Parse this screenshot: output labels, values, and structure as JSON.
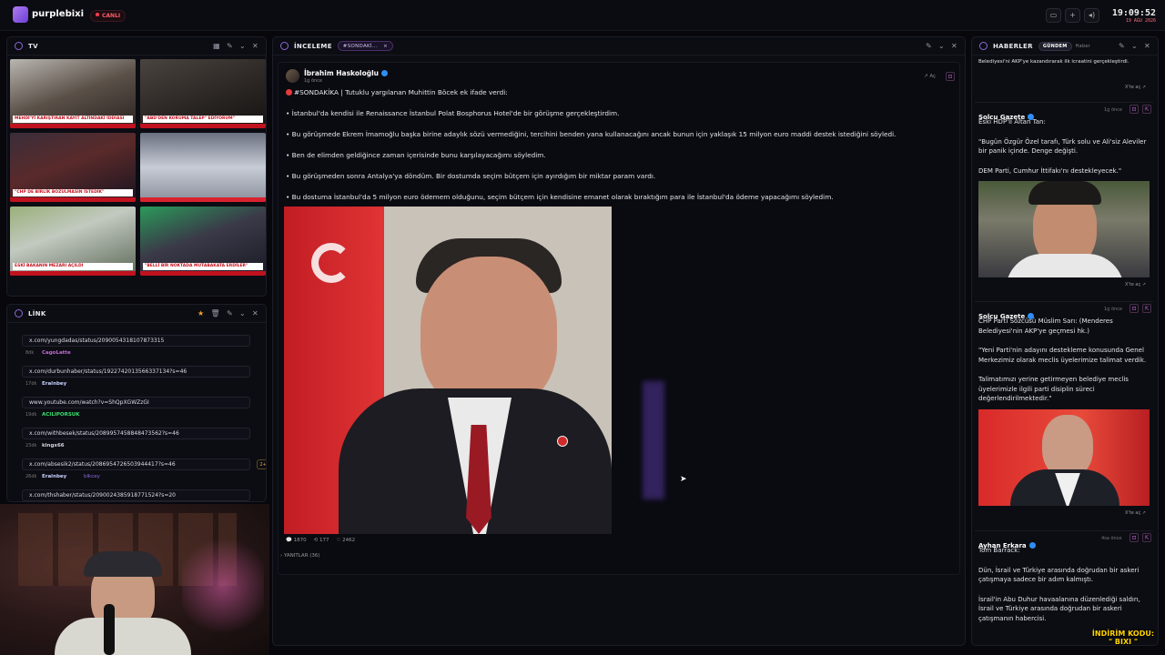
{
  "topbar": {
    "logo": "purplebixi",
    "live": "CANLI",
    "clock": "19:09:52",
    "date": "19 AĞU 2026"
  },
  "tv": {
    "title": "TV",
    "tiles": [
      {
        "caption": "MEHDİ'Yİ KARIŞTIRAN KAYIT ALTINDAKİ İDDİASI"
      },
      {
        "caption": "\"ABD'DEN KORUMA TALEP\" EDİYORUM\""
      },
      {
        "caption": "\"CHP DE BİRLİK BOZULMASIN İSTEDİK\""
      },
      {
        "caption": ""
      },
      {
        "caption": "ESKİ BAKANIN MEZARI AÇILDI"
      },
      {
        "caption": "\"BELLİ BİR NOKTADA MUTABAKATA ERDİLER\""
      }
    ]
  },
  "link": {
    "title": "LİNK",
    "items": [
      {
        "url": "x.com/yungdadas/status/2090054318107873315",
        "age": "8dk",
        "user": "CagoLatte",
        "user_color": "#c46ad6",
        "extra": "",
        "badge": ""
      },
      {
        "url": "x.com/durbunhaber/status/1922742013566337134?s=46",
        "age": "17dk",
        "user": "Eralnbey",
        "user_color": "#c9d3ff",
        "extra": "",
        "badge": ""
      },
      {
        "url": "www.youtube.com/watch?v=ShQpXGWZzGI",
        "age": "19dk",
        "user": "ACILIPORSUK",
        "user_color": "#38e06b",
        "extra": "",
        "badge": ""
      },
      {
        "url": "x.com/withbesek/status/2089957458848473562?s=46",
        "age": "23dk",
        "user": "klngx66",
        "user_color": "#d6d6e0",
        "extra": "",
        "badge": ""
      },
      {
        "url": "x.com/absesik2/status/2086954726503944417?s=46",
        "age": "26dk",
        "user": "Eralnbey",
        "user_color": "#c9d3ff",
        "extra": "blkcey",
        "badge": "2+"
      },
      {
        "url": "x.com/thshaber/status/2090024385918771524?s=20",
        "age": "",
        "user": "",
        "user_color": "#d6d6e0",
        "extra": "",
        "badge": ""
      }
    ]
  },
  "inceleme": {
    "title": "İNCELEME",
    "tab": "#SONDAKİ...",
    "author": "İbrahim Haskoloğlu",
    "time": "1g önce",
    "open": "Aç",
    "lines": [
      "#SONDAKİKA | Tutuklu yargılanan Muhittin Böcek ek ifade verdi:",
      "• İstanbul'da kendisi ile Renaissance İstanbul Polat Bosphorus Hotel'de bir görüşme gerçekleştirdim.",
      "• Bu görüşmede Ekrem İmamoğlu başka birine adaylık sözü vermediğini, tercihini benden yana kullanacağını ancak bunun için yaklaşık 15 milyon euro maddi destek istediğini söyledi.",
      "• Ben de elimden geldiğince zaman içerisinde bunu karşılayacağımı söyledim.",
      "• Bu görüşmeden sonra Antalya'ya döndüm. Bir dostumda seçim bütçem için ayırdığım bir miktar param vardı.",
      "• Bu dostuma İstanbul'da 5 milyon euro ödemem olduğunu, seçim bütçem için kendisine emanet olarak bıraktığım para ile İstanbul'da ödeme yapacağımı söyledim."
    ],
    "replies": "1870",
    "reposts": "177",
    "likes": "2462",
    "thread": "YANITLAR (36)"
  },
  "news": {
    "title": "HABERLER",
    "tabs": [
      "GÜNDEM",
      "Haber"
    ],
    "open_label": "X'te aç",
    "top_text": "Belediyesi'ni AKP'ye kazandırarak ilk icraatini gerçekleştirdi.",
    "items": [
      {
        "source": "Solcu Gazete",
        "time": "1g önce",
        "body": [
          "Eski HDP'li Altan Tan:",
          "",
          "\"Bugün Özgür Özel tarafı, Türk solu ve Ali'siz Aleviler bir panik içinde. Denge değişti.",
          "",
          "DEM Parti, Cumhur İttifakı'nı destekleyecek.\""
        ]
      },
      {
        "source": "Solcu Gazete",
        "time": "1g önce",
        "body": [
          "CHP Parti Sözcüsü Müslim Sarı: (Menderes Belediyesi'nin AKP'ye geçmesi hk.)",
          "",
          "\"Yeni Parti'nin adayını destekleme konusunda Genel Merkezimiz olarak meclis üyelerimize talimat verdik.",
          "",
          "Talimatımızı yerine getirmeyen belediye meclis üyelerimizle ilgili parti disiplin süreci değerlendirilmektedir.\""
        ]
      },
      {
        "source": "Ayhan Erkara",
        "time": "4sa önce",
        "body": [
          "Tom Barrack:",
          "",
          "Dün, İsrail ve Türkiye arasında doğrudan bir askeri çatışmaya sadece bir adım kalmıştı.",
          "",
          "İsrail'in Abu Duhur havaalanına düzenlediği saldırı, İsrail ve Türkiye arasında doğrudan bir askeri çatışmanın habercisi."
        ]
      }
    ]
  },
  "promo": {
    "line1": "İNDİRİM KODU:",
    "line2": "\" BIXI \""
  },
  "colors": {
    "accent": "#8a6bde",
    "live": "#ff3b4f",
    "verified": "#2f8ef5",
    "promo": "#ffd400"
  }
}
